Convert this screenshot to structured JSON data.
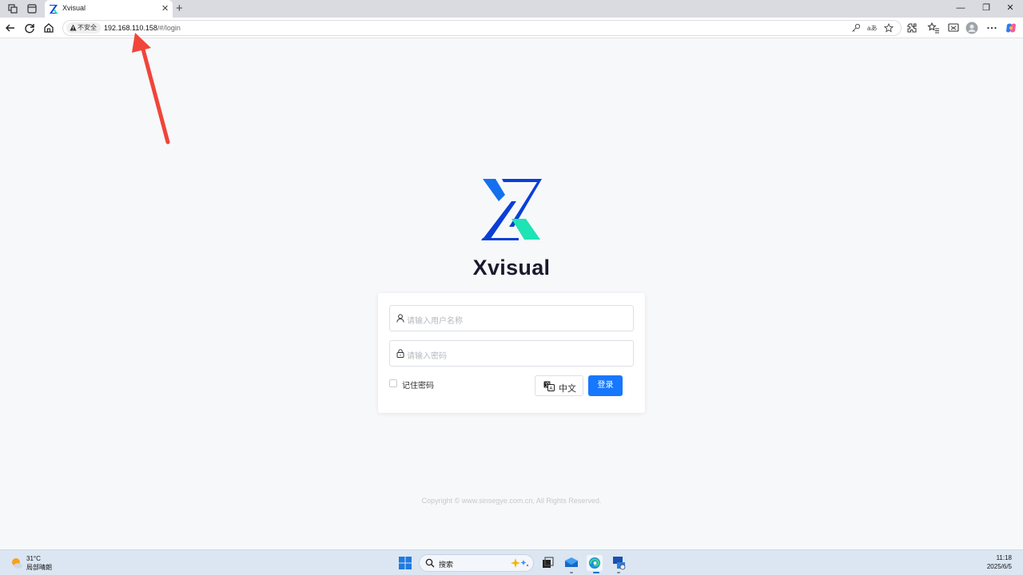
{
  "browser": {
    "tab_title": "Xvisual",
    "tab_close": "✕",
    "new_tab": "+",
    "window_controls": {
      "minimize": "—",
      "restore": "❐",
      "close": "✕"
    },
    "security_label": "不安全",
    "url_host": "192.168.110.158",
    "url_path": "/#/login",
    "addr_icons": [
      "key-icon",
      "read-aloud-icon",
      "favorite-star-icon"
    ],
    "toolbar_icons": [
      "back-icon",
      "refresh-icon",
      "home-icon",
      "extensions-icon",
      "favorites-icon",
      "screen-cast-icon",
      "profile-avatar",
      "more-icon",
      "copilot-icon"
    ]
  },
  "page": {
    "brand": "Xvisual",
    "username_placeholder": "请输入用户名称",
    "password_placeholder": "请输入密码",
    "remember_label": "记住密码",
    "language_label": "中文",
    "login_label": "登录",
    "copyright": "Copyright © www.sinsegye.com.cn, All Rights Reserved.",
    "colors": {
      "primary": "#1677ff",
      "logo_blue": "#0a3fd6",
      "logo_teal": "#1ee3b4",
      "annotation_red": "#f0453a"
    }
  },
  "taskbar": {
    "temperature": "31°C",
    "condition": "局部晴朗",
    "search_label": "搜索",
    "time": "11:18",
    "date": "2025/6/5"
  }
}
